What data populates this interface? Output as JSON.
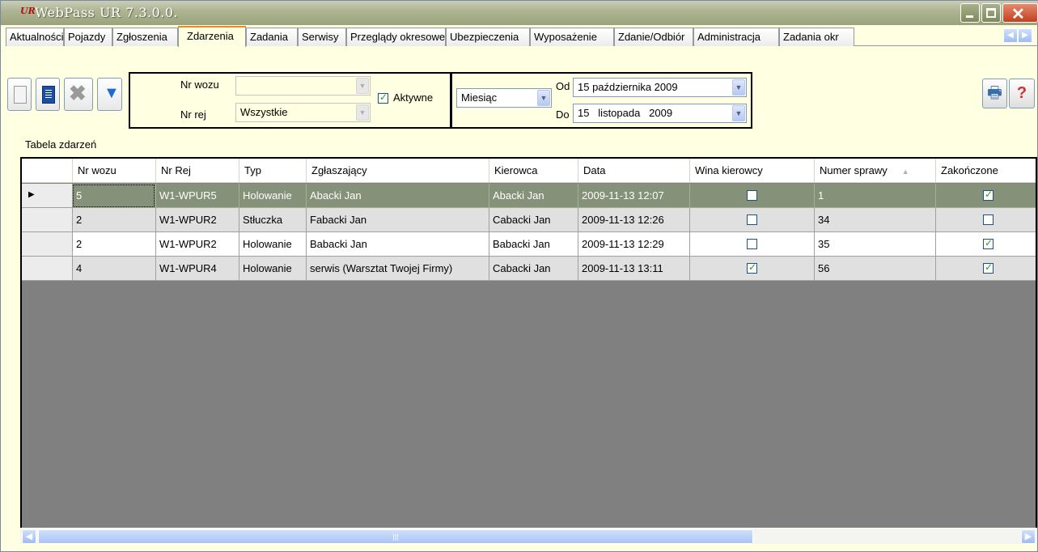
{
  "window": {
    "title": "WebPass UR 7.3.0.0.",
    "logo_text": "UR"
  },
  "tabs": [
    {
      "label": "Aktualności"
    },
    {
      "label": "Pojazdy"
    },
    {
      "label": "Zgłoszenia"
    },
    {
      "label": "Zdarzenia",
      "active": true
    },
    {
      "label": "Zadania"
    },
    {
      "label": "Serwisy"
    },
    {
      "label": "Przeglądy okresowe"
    },
    {
      "label": "Ubezpieczenia"
    },
    {
      "label": "Wyposażenie"
    },
    {
      "label": "Zdanie/Odbiór"
    },
    {
      "label": "Administracja"
    },
    {
      "label": "Zadania okr"
    }
  ],
  "toolbar": {
    "buttons": [
      "new-document-icon",
      "document-icon",
      "delete-icon",
      "filter-icon"
    ]
  },
  "filters": {
    "nr_wozu_label": "Nr wozu",
    "nr_wozu_value": "",
    "nr_rej_label": "Nr rej",
    "nr_rej_value": "Wszystkie",
    "aktywne_label": "Aktywne",
    "aktywne_checked": true,
    "period_value": "Miesiąc",
    "od_label": "Od",
    "od_value": "15 października 2009",
    "do_label": "Do",
    "do_value": "15   listopada   2009"
  },
  "table": {
    "caption": "Tabela zdarzeń",
    "columns": [
      "Nr wozu",
      "Nr Rej",
      "Typ",
      "Zgłaszający",
      "Kierowca",
      "Data",
      "Wina kierowcy",
      "Numer sprawy",
      "Zakończone"
    ],
    "rows": [
      [
        "5",
        "W1-WPUR5",
        "Holowanie",
        "Abacki Jan",
        "Abacki Jan",
        "2009-11-13 12:07",
        false,
        "1",
        true
      ],
      [
        "2",
        "W1-WPUR2",
        "Stłuczka",
        "Fabacki Jan",
        "Cabacki Jan",
        "2009-11-13 12:26",
        false,
        "34",
        false
      ],
      [
        "2",
        "W1-WPUR2",
        "Holowanie",
        "Babacki Jan",
        "Babacki Jan",
        "2009-11-13 12:29",
        false,
        "35",
        true
      ],
      [
        "4",
        "W1-WPUR4",
        "Holowanie",
        "serwis (Warsztat Twojej Firmy)",
        "Cabacki Jan",
        "2009-11-13 13:11",
        true,
        "56",
        true
      ]
    ],
    "selected_row": 0
  },
  "colors": {
    "panel": "#ffffe1",
    "selected_row": "#86917a",
    "grid_empty": "#808080",
    "title_bar": "#9aa27c"
  }
}
